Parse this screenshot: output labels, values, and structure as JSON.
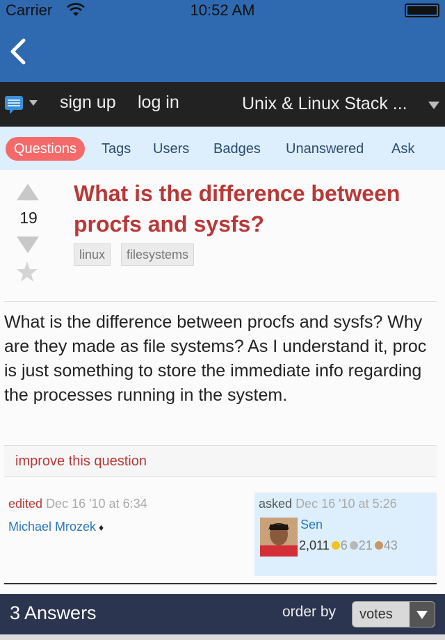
{
  "status_bar": {
    "carrier": "Carrier",
    "time": "10:52 AM",
    "icons": [
      "wifi-icon",
      "battery-icon"
    ]
  },
  "nav_bar": {
    "back_icon": "back-chevron-icon",
    "color": "#2f6ab0"
  },
  "site_bar": {
    "menu_icon": "chat-menu-icon",
    "signup": "sign up",
    "login": "log in",
    "site_name": "Unix & Linux Stack ..."
  },
  "tabs": [
    {
      "label": "Questions",
      "active": true
    },
    {
      "label": "Tags",
      "active": false
    },
    {
      "label": "Users",
      "active": false
    },
    {
      "label": "Badges",
      "active": false
    },
    {
      "label": "Unanswered",
      "active": false
    },
    {
      "label": "Ask",
      "active": false
    }
  ],
  "question": {
    "votes": "19",
    "title": "What is the difference between procfs and sysfs?",
    "tags": [
      "linux",
      "filesystems"
    ],
    "body": "What is the difference between procfs and sysfs? Why are they made as file systems? As I understand it, proc is just something to store the immediate info regarding the processes running in the system.",
    "improve_link": "improve this question",
    "edited": {
      "label": "edited",
      "time": "Dec 16 '10 at 6:34",
      "user": "Michael Mrozek",
      "moderator_mark": "♦"
    },
    "asked": {
      "label": "asked",
      "time": "Dec 16 '10 at 5:26",
      "user": "Sen",
      "reputation": "2,011",
      "badges": {
        "gold": "6",
        "silver": "21",
        "bronze": "43"
      }
    }
  },
  "answers_bar": {
    "count_label": "3 Answers",
    "order_label": "order by",
    "order_value": "votes"
  },
  "colors": {
    "accent": "#2f6ab0",
    "title_red": "#b93837",
    "active_tab": "#f46a6a",
    "link_blue": "#2a78c0",
    "gold": "#f2c21d",
    "silver": "#b8b8b8",
    "bronze": "#c99566"
  }
}
